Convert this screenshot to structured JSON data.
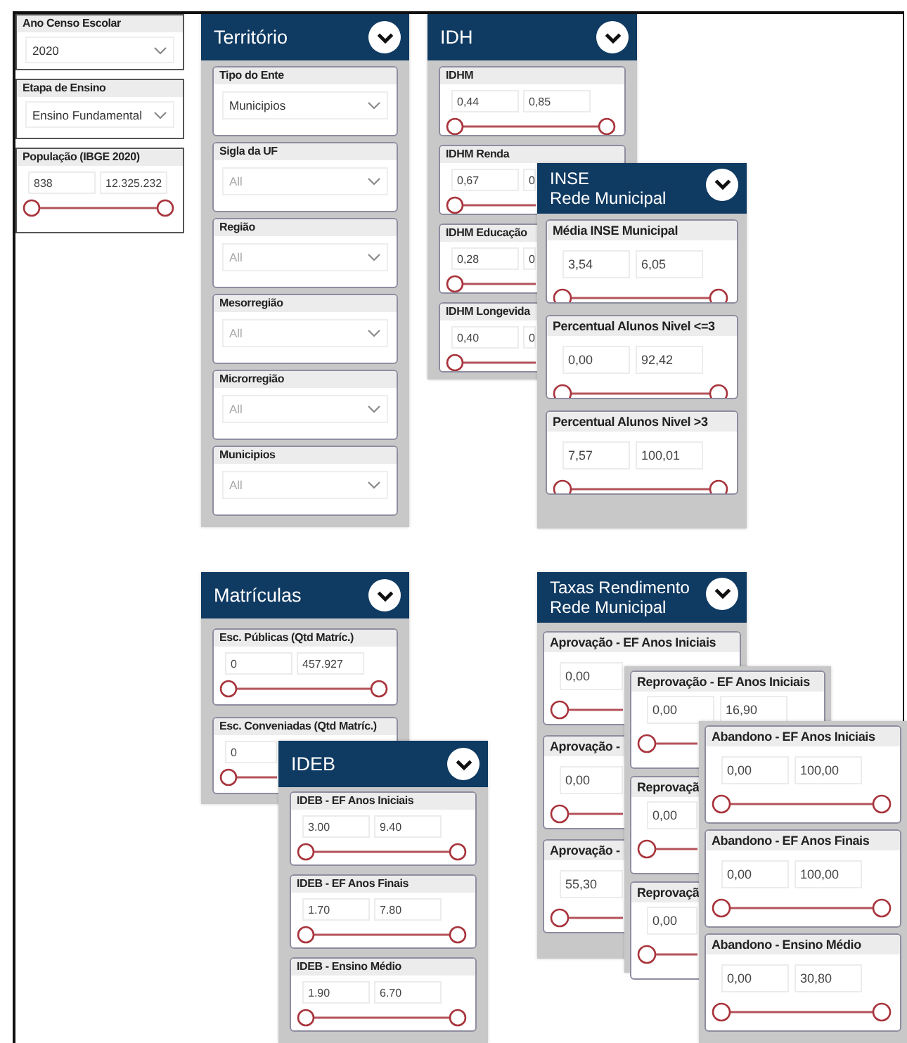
{
  "filters": [
    {
      "kind": "dropdown",
      "title": "Ano Censo Escolar",
      "value": "2020"
    },
    {
      "kind": "dropdown",
      "title": "Etapa de Ensino",
      "value": "Ensino Fundamental"
    },
    {
      "kind": "range",
      "title": "População (IBGE 2020)",
      "values": [
        "838",
        "12.325.232"
      ],
      "thumbs": [
        {
          "level": 0
        },
        {
          "level": 1
        }
      ]
    }
  ],
  "panels": [
    {
      "title": "Território",
      "cards": [
        {
          "kind": "dropdown",
          "title": "Tipo do Ente",
          "value": "Municipios"
        },
        {
          "kind": "dropdown",
          "title": "Sigla da UF",
          "placeholder": "All"
        },
        {
          "kind": "dropdown",
          "title": "Região",
          "placeholder": "All"
        },
        {
          "kind": "dropdown",
          "title": "Mesorregião",
          "placeholder": "All"
        },
        {
          "kind": "dropdown",
          "title": "Microrregião",
          "placeholder": "All"
        },
        {
          "kind": "dropdown",
          "title": "Municipios",
          "placeholder": "All"
        }
      ]
    },
    {
      "title": "IDH",
      "cards": [
        {
          "kind": "range",
          "title": "IDHM",
          "values": [
            "0,44",
            "0,85"
          ],
          "thumbs": [
            {
              "level": 0
            },
            {
              "level": 1
            }
          ]
        },
        {
          "kind": "range",
          "title": "IDHM Renda",
          "values": [
            "0,67",
            "0"
          ],
          "thumbs": [
            {
              "level": 0
            }
          ]
        },
        {
          "kind": "range",
          "title": "IDHM Educação",
          "values": [
            "0,28",
            "0"
          ],
          "thumbs": [
            {
              "level": 0
            }
          ]
        },
        {
          "kind": "range",
          "title": "IDHM Longevida",
          "values": [
            "0,40",
            "0"
          ],
          "thumbs": [
            {
              "level": 0
            }
          ]
        }
      ]
    },
    {
      "title": "INSE",
      "subtitle": "Rede Municipal",
      "cards": [
        {
          "kind": "range",
          "title": "Média INSE Municipal",
          "values": [
            "3,54",
            "6,05"
          ],
          "thumbs": [
            {
              "level": 0
            },
            {
              "level": 1
            }
          ]
        },
        {
          "kind": "range",
          "title": "Percentual Alunos Nivel <=3",
          "values": [
            "0,00",
            "92,42"
          ],
          "thumbs": [
            {
              "level": 0
            },
            {
              "level": 1
            }
          ]
        },
        {
          "kind": "range",
          "title": "Percentual Alunos Nivel >3",
          "values": [
            "7,57",
            "100,01"
          ],
          "thumbs": [
            {
              "level": 0
            },
            {
              "level": 1
            }
          ]
        }
      ]
    },
    {
      "title": "Matrículas",
      "cards": [
        {
          "kind": "range",
          "title": "Esc. Públicas (Qtd Matríc.)",
          "values": [
            "0",
            "457.927"
          ],
          "thumbs": [
            {
              "level": 0
            },
            {
              "level": 1
            }
          ]
        },
        {
          "kind": "range",
          "title": "Esc. Conveniadas (Qtd Matríc.)",
          "values": [
            "0"
          ],
          "thumbs": [
            {
              "level": 0
            }
          ]
        }
      ]
    },
    {
      "title": "IDEB",
      "cards": [
        {
          "kind": "range",
          "title": "IDEB - EF Anos Iniciais",
          "values": [
            "3.00",
            "9.40"
          ],
          "thumbs": [
            {
              "level": 0
            },
            {
              "level": 1
            }
          ]
        },
        {
          "kind": "range",
          "title": "IDEB - EF Anos Finais",
          "values": [
            "1.70",
            "7.80"
          ],
          "thumbs": [
            {
              "level": 0
            },
            {
              "level": 1
            }
          ]
        },
        {
          "kind": "range",
          "title": "IDEB - Ensino Médio",
          "values": [
            "1.90",
            "6.70"
          ],
          "thumbs": [
            {
              "level": 0
            },
            {
              "level": 1
            }
          ]
        }
      ]
    },
    {
      "title": "Taxas Rendimento",
      "subtitle": "Rede Municipal",
      "cards": [
        {
          "kind": "range",
          "title": "Aprovação - EF Anos Iniciais",
          "values": [
            "0,00"
          ],
          "thumbs": [
            {
              "level": 0
            }
          ]
        },
        {
          "kind": "range",
          "title": "Aprovação -",
          "values": [
            "0,00"
          ],
          "thumbs": [
            {
              "level": 0
            }
          ]
        },
        {
          "kind": "range",
          "title": "Aprovação -",
          "values": [
            "55,30"
          ],
          "thumbs": [
            {
              "level": 0
            }
          ]
        }
      ]
    },
    {
      "cards": [
        {
          "kind": "range",
          "title": "Reprovação - EF Anos Iniciais",
          "values": [
            "0,00",
            "16,90"
          ],
          "thumbs": [
            {
              "level": 0
            }
          ]
        },
        {
          "kind": "range",
          "title": "Reprovaçã",
          "values": [
            "0,00"
          ],
          "thumbs": [
            {
              "level": 0
            }
          ]
        },
        {
          "kind": "range",
          "title": "Reprovaçã",
          "values": [
            "0,00"
          ],
          "thumbs": [
            {
              "level": 0
            }
          ]
        }
      ]
    },
    {
      "cards": [
        {
          "kind": "range",
          "title": "Abandono - EF Anos Iniciais",
          "values": [
            "0,00",
            "100,00"
          ],
          "thumbs": [
            {
              "level": 0
            },
            {
              "level": 1
            }
          ]
        },
        {
          "kind": "range",
          "title": "Abandono - EF Anos Finais",
          "values": [
            "0,00",
            "100,00"
          ],
          "thumbs": [
            {
              "level": 0
            },
            {
              "level": 1
            }
          ]
        },
        {
          "kind": "range",
          "title": "Abandono - Ensino Médio",
          "values": [
            "0,00",
            "30,80"
          ],
          "thumbs": [
            {
              "level": 0
            },
            {
              "level": 1
            }
          ]
        }
      ]
    }
  ]
}
